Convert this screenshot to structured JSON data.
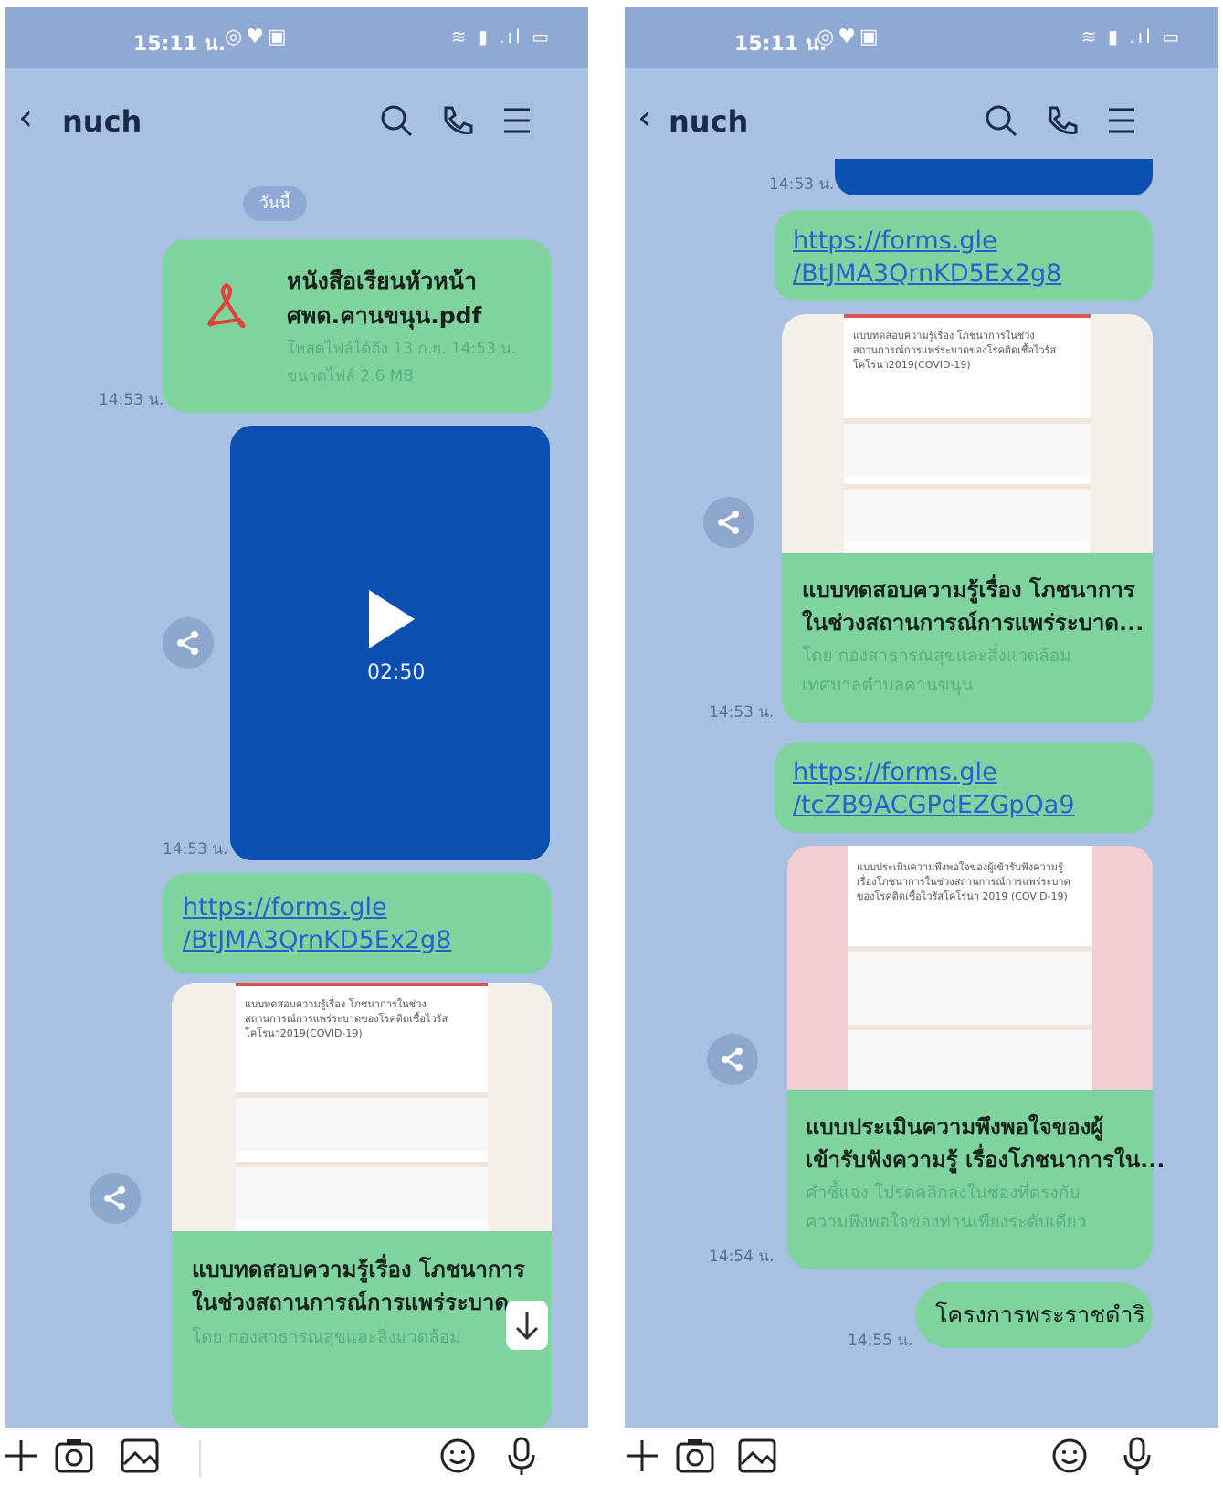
{
  "left": {
    "status": {
      "time": "15:11 น."
    },
    "header": {
      "contact": "nuch"
    },
    "date_pill": "วันนี้",
    "file": {
      "name_line1": "หนังสือเรียนหัวหน้า",
      "name_line2": "ศพด.คานขนุน.pdf",
      "info_line1": "โหลดไฟล์ได้ถึง 13 ก.ย. 14:53 น.",
      "info_line2": "ขนาดไฟล์ 2.6 MB",
      "time": "14:53 น."
    },
    "video": {
      "duration": "02:50",
      "time": "14:53 น."
    },
    "link": {
      "line1": "https://forms.gle",
      "line2": "/BtJMA3QrnKD5Ex2g8"
    },
    "card": {
      "title1": "แบบทดสอบความรู้เรื่อง โภชนาการ",
      "title2": "ในช่วงสถานการณ์การแพร่ระบาด.",
      "sub1": "โดย กองสาธารณสุขและสิ่งแวดล้อม",
      "preview": "แบบทดสอบความรู้เรื่อง โภชนาการในช่วง สถานการณ์การแพร่ระบาดของโรคติดเชื้อไวรัส โคโรนา2019(COVID-19)"
    }
  },
  "right": {
    "status": {
      "time": "15:11 น."
    },
    "header": {
      "contact": "nuch"
    },
    "top_time": "14:53 น.",
    "link1": {
      "line1": "https://forms.gle",
      "line2": "/BtJMA3QrnKD5Ex2g8"
    },
    "card1": {
      "preview": "แบบทดสอบความรู้เรื่อง โภชนาการในช่วง สถานการณ์การแพร่ระบาดของโรคติดเชื้อไวรัส โคโรนา2019(COVID-19)",
      "title1": "แบบทดสอบความรู้เรื่อง โภชนาการ",
      "title2": "ในช่วงสถานการณ์การแพร่ระบาด...",
      "sub1": "โดย กองสาธารณสุขและสิ่งแวดล้อม",
      "sub2": "เทศบาลตำบลคานขนุน",
      "time": "14:53 น."
    },
    "link2": {
      "line1": "https://forms.gle",
      "line2": "/tcZB9ACGPdEZGpQa9"
    },
    "card2": {
      "preview": "แบบประเมินความพึงพอใจของผู้เข้ารับฟังความรู้ เรื่องโภชนาการในช่วงสถานการณ์การแพร่ระบาด ของโรคติดเชื้อไวรัสโคโรนา 2019 (COVID-19)",
      "title1": "แบบประเมินความพึงพอใจของผู้",
      "title2": "เข้ารับฟังความรู้ เรื่องโภชนาการใน...",
      "sub1": "คำชี้แจง โปรดคลิกลงในช่องที่ตรงกับ",
      "sub2": "ความพึงพอใจของท่านเพียงระดับเดียว",
      "time": "14:54 น."
    },
    "last": {
      "text": "โครงการพระราชดำริ",
      "time": "14:55 น."
    }
  }
}
